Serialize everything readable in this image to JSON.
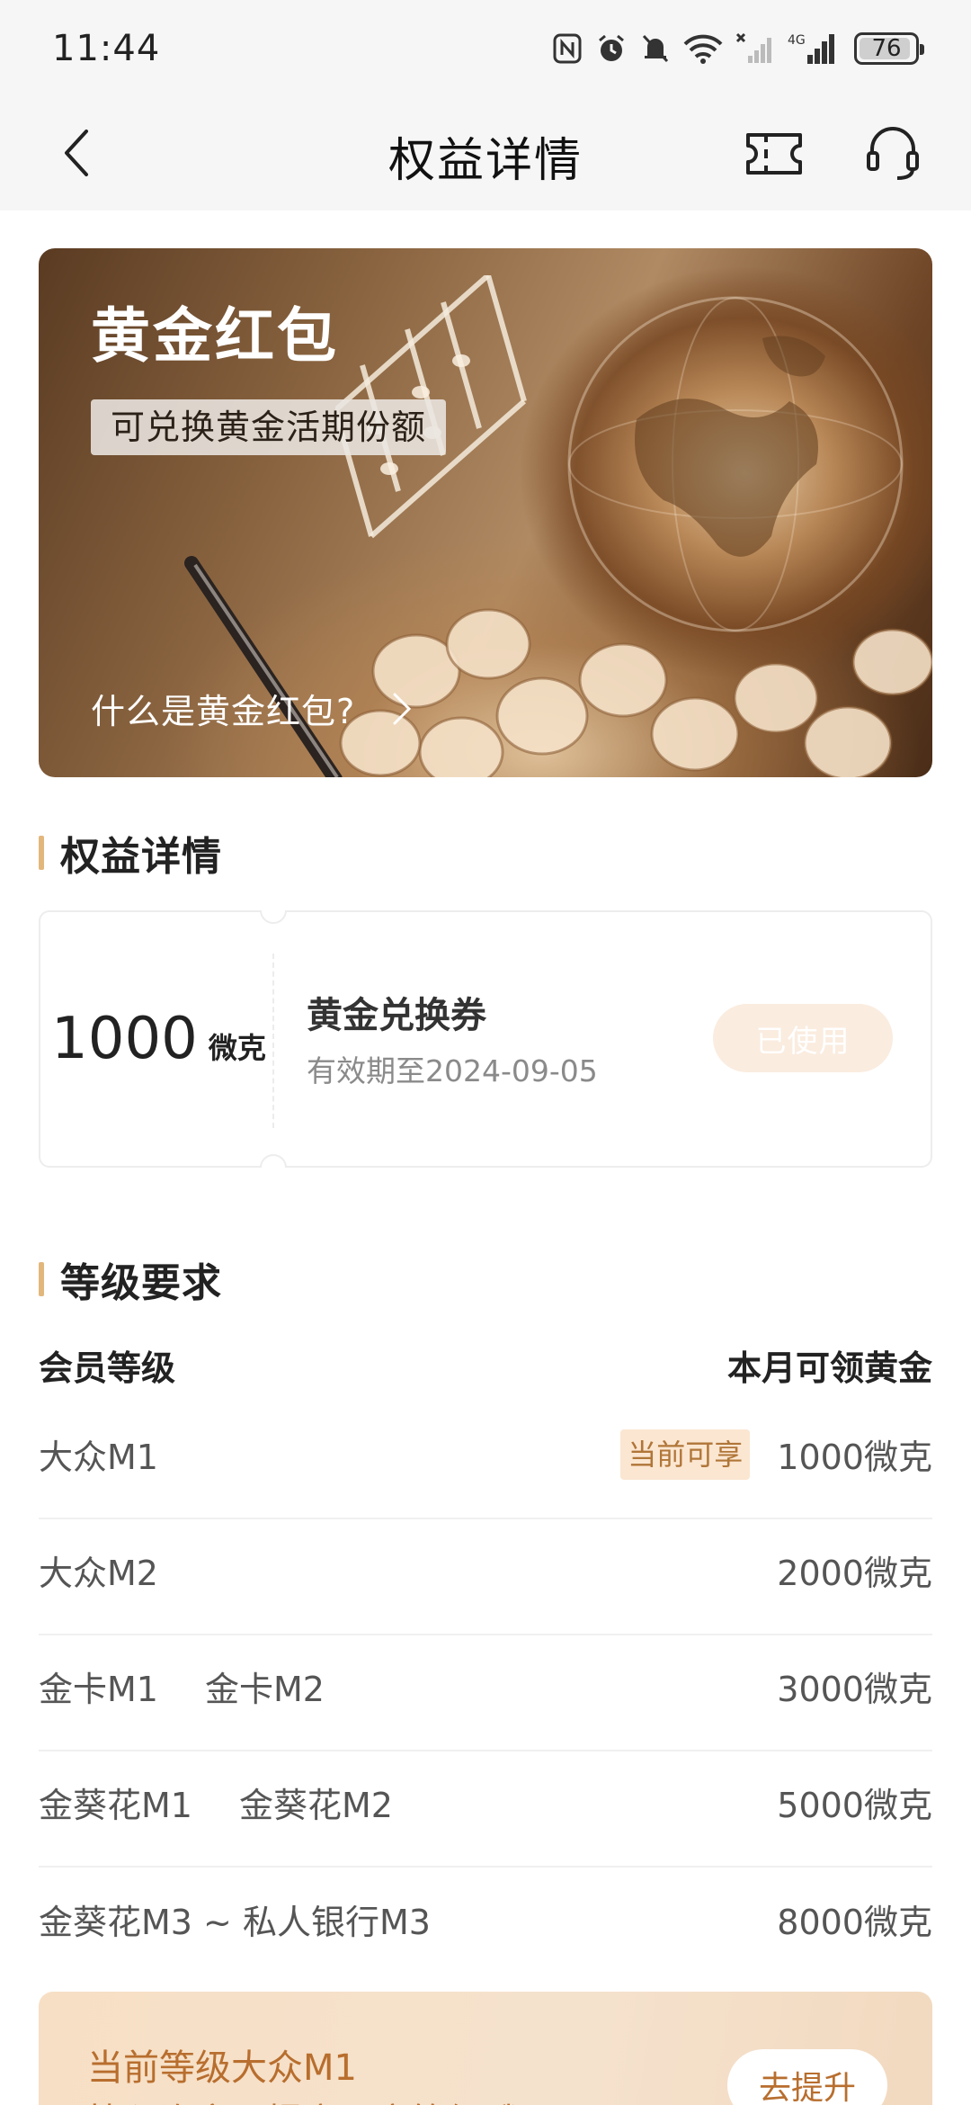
{
  "status_bar": {
    "time": "11:44",
    "battery": "76",
    "icons": [
      "nfc-icon",
      "alarm-icon",
      "mute-icon",
      "wifi-icon",
      "signal-no-sim-icon",
      "signal-4g-icon",
      "battery-icon"
    ],
    "network_label": "4G"
  },
  "nav": {
    "title": "权益详情",
    "icons": [
      "back-icon",
      "ticket-icon",
      "headset-icon"
    ]
  },
  "banner": {
    "title": "黄金红包",
    "tag": "可兑换黄金活期份额",
    "link": "什么是黄金红包?"
  },
  "benefit_section": {
    "title": "权益详情"
  },
  "coupon": {
    "amount": "1000",
    "unit": "微克",
    "name": "黄金兑换券",
    "validity": "有效期至2024-09-05",
    "status_button": "已使用"
  },
  "level_section": {
    "title": "等级要求",
    "col_left": "会员等级",
    "col_right": "本月可领黄金",
    "rows": [
      {
        "names": [
          "大众M1"
        ],
        "badge": "当前可享",
        "amount": "1000微克"
      },
      {
        "names": [
          "大众M2"
        ],
        "amount": "2000微克"
      },
      {
        "names": [
          "金卡M1",
          "金卡M2"
        ],
        "amount": "3000微克"
      },
      {
        "names": [
          "金葵花M1",
          "金葵花M2"
        ],
        "amount": "5000微克"
      },
      {
        "names": [
          "金葵花M3 ~ 私人银行M3"
        ],
        "amount": "8000微克"
      }
    ]
  },
  "upgrade_card": {
    "line1": "当前等级大众M1",
    "line2": "快入资产可提高用户等级哦",
    "button": "去提升"
  },
  "colors": {
    "accent_bar": "#e2b77c",
    "badge_bg": "#fbe6d1",
    "badge_text": "#b07638",
    "used_button_bg": "#faecdf",
    "upgrade_text": "#b86e2e"
  }
}
